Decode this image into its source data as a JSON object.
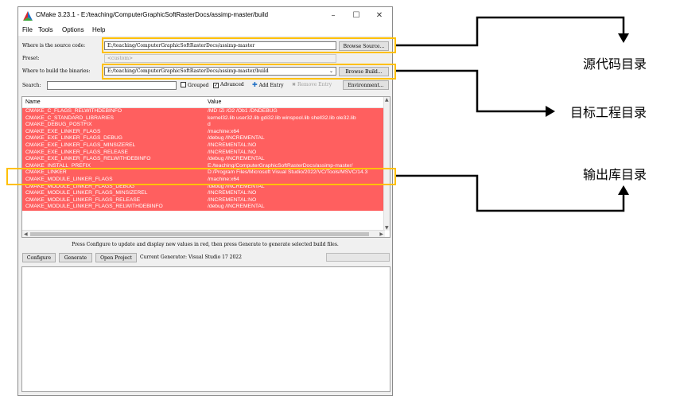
{
  "window": {
    "title": "CMake 3.23.1 - E:/teaching/ComputerGraphicSoftRasterDocs/assimp-master/build",
    "min": "–",
    "max": "☐",
    "close": "✕"
  },
  "menu": [
    "File",
    "Tools",
    "Options",
    "Help"
  ],
  "source": {
    "label": "Where is the source code:",
    "value": "E:/teaching/ComputerGraphicSoftRasterDocs/assimp-master",
    "button": "Browse Source..."
  },
  "preset": {
    "label": "Preset:",
    "value": "<custom>"
  },
  "binaries": {
    "label": "Where to build the binaries:",
    "value": "E:/teaching/ComputerGraphicSoftRasterDocs/assimp-master/build",
    "button": "Browse Build..."
  },
  "search": {
    "label": "Search:",
    "value": ""
  },
  "toolbar": {
    "grouped": "Grouped",
    "advanced": "Advanced",
    "add_entry": "Add Entry",
    "remove_entry": "Remove Entry",
    "environment": "Environment..."
  },
  "table": {
    "col_name": "Name",
    "col_value": "Value",
    "rows": [
      {
        "name": "CMAKE_C_FLAGS_RELWITHDEBINFO",
        "value": "/MD /Zi /O2 /Ob1 /DNDEBUG"
      },
      {
        "name": "CMAKE_C_STANDARD_LIBRARIES",
        "value": "kernel32.lib user32.lib gdi32.lib winspool.lib shell32.lib ole32.lib"
      },
      {
        "name": "CMAKE_DEBUG_POSTFIX",
        "value": "d"
      },
      {
        "name": "CMAKE_EXE_LINKER_FLAGS",
        "value": "/machine:x64"
      },
      {
        "name": "CMAKE_EXE_LINKER_FLAGS_DEBUG",
        "value": "/debug /INCREMENTAL"
      },
      {
        "name": "CMAKE_EXE_LINKER_FLAGS_MINSIZEREL",
        "value": "/INCREMENTAL:NO"
      },
      {
        "name": "CMAKE_EXE_LINKER_FLAGS_RELEASE",
        "value": "/INCREMENTAL:NO"
      },
      {
        "name": "CMAKE_EXE_LINKER_FLAGS_RELWITHDEBINFO",
        "value": "/debug /INCREMENTAL"
      },
      {
        "name": "CMAKE_INSTALL_PREFIX",
        "value": "E:/teaching/ComputerGraphicSoftRasterDocs/assimp-master/"
      },
      {
        "name": "CMAKE_LINKER",
        "value": "D:/Program Files/Microsoft Visual Studio/2022/VC/Tools/MSVC/14.3"
      },
      {
        "name": "CMAKE_MODULE_LINKER_FLAGS",
        "value": "/machine:x64"
      },
      {
        "name": "CMAKE_MODULE_LINKER_FLAGS_DEBUG",
        "value": "/debug /INCREMENTAL"
      },
      {
        "name": "CMAKE_MODULE_LINKER_FLAGS_MINSIZEREL",
        "value": "/INCREMENTAL:NO"
      },
      {
        "name": "CMAKE_MODULE_LINKER_FLAGS_RELEASE",
        "value": "/INCREMENTAL:NO"
      },
      {
        "name": "CMAKE_MODULE_LINKER_FLAGS_RELWITHDEBINFO",
        "value": "/debug /INCREMENTAL"
      }
    ],
    "row_color": "#ff5f5f"
  },
  "info_text": "Press Configure to update and display new values in red, then press Generate to generate selected build files.",
  "buttons": {
    "configure": "Configure",
    "generate": "Generate",
    "open_project": "Open Project"
  },
  "generator_text": "Current Generator: Visual Studio 17 2022",
  "annotations": {
    "source": "源代码目录",
    "binaries": "目标工程目录",
    "install": "输出库目录",
    "highlight_color": "#ffc000"
  }
}
